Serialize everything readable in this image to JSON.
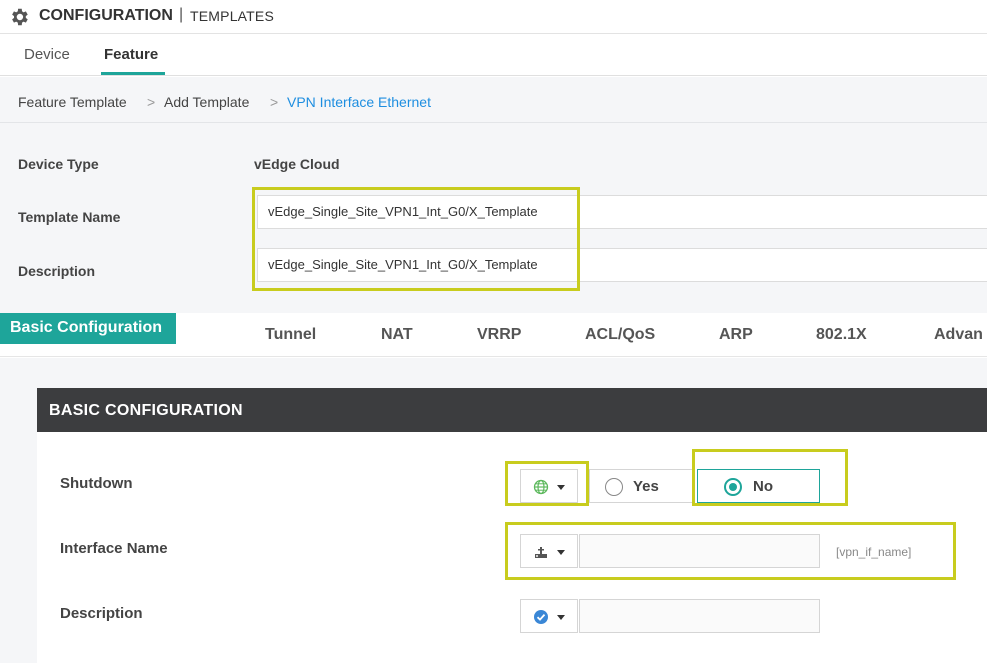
{
  "header": {
    "title": "CONFIGURATION",
    "separator": "|",
    "subtitle": "TEMPLATES",
    "icon": "gear-icon"
  },
  "tabs": [
    {
      "label": "Device",
      "active": false
    },
    {
      "label": "Feature",
      "active": true
    }
  ],
  "breadcrumb": {
    "items": [
      "Feature Template",
      "Add Template",
      "VPN Interface Ethernet"
    ],
    "separator": ">"
  },
  "meta": {
    "device_type_label": "Device Type",
    "device_type_value": "vEdge Cloud",
    "template_name_label": "Template Name",
    "template_name_value": "vEdge_Single_Site_VPN1_Int_G0/X_Template",
    "description_label": "Description",
    "description_value": "vEdge_Single_Site_VPN1_Int_G0/X_Template"
  },
  "subtabs": [
    "Basic Configuration",
    "Tunnel",
    "NAT",
    "VRRP",
    "ACL/QoS",
    "ARP",
    "802.1X",
    "Advan"
  ],
  "basic": {
    "heading": "BASIC CONFIGURATION",
    "shutdown": {
      "label": "Shutdown",
      "scope_icon": "globe-icon",
      "options": [
        "Yes",
        "No"
      ],
      "selected": "No"
    },
    "interface_name": {
      "label": "Interface Name",
      "scope_icon": "device-specific-icon",
      "value": "",
      "variable_hint": "[vpn_if_name]"
    },
    "description": {
      "label": "Description",
      "scope_icon": "check-circle-icon",
      "value": ""
    }
  },
  "colors": {
    "accent": "#1ea59a",
    "link": "#1e8ee0",
    "panel_header": "#3c3d3f",
    "highlight": "#c8cc1e"
  }
}
